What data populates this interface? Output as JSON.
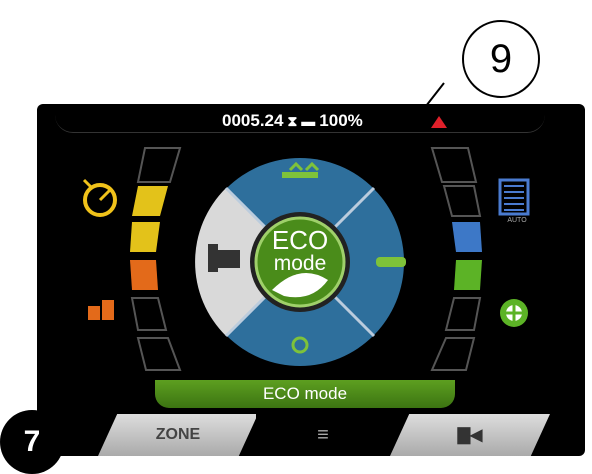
{
  "header": {
    "hours": "0005.24",
    "battery_percent": "100%"
  },
  "callouts": {
    "top_right": "9",
    "bottom_left": "7"
  },
  "center": {
    "eco_line1": "ECO",
    "eco_line2": "mode"
  },
  "status_bar": {
    "mode_label": "ECO mode"
  },
  "tabs": {
    "zone_label": "ZONE",
    "menu_icon": "menu-icon",
    "camera_icon": "camera-icon"
  },
  "right_panel": {
    "auto_label": "AUTO"
  },
  "colors": {
    "eco_green": "#4a8c1a",
    "segment_yellow": "#e3c21a",
    "segment_orange": "#e36a1a",
    "segment_blue": "#3d78c7",
    "segment_green": "#5cb326",
    "alarm_red": "#e0202a"
  }
}
